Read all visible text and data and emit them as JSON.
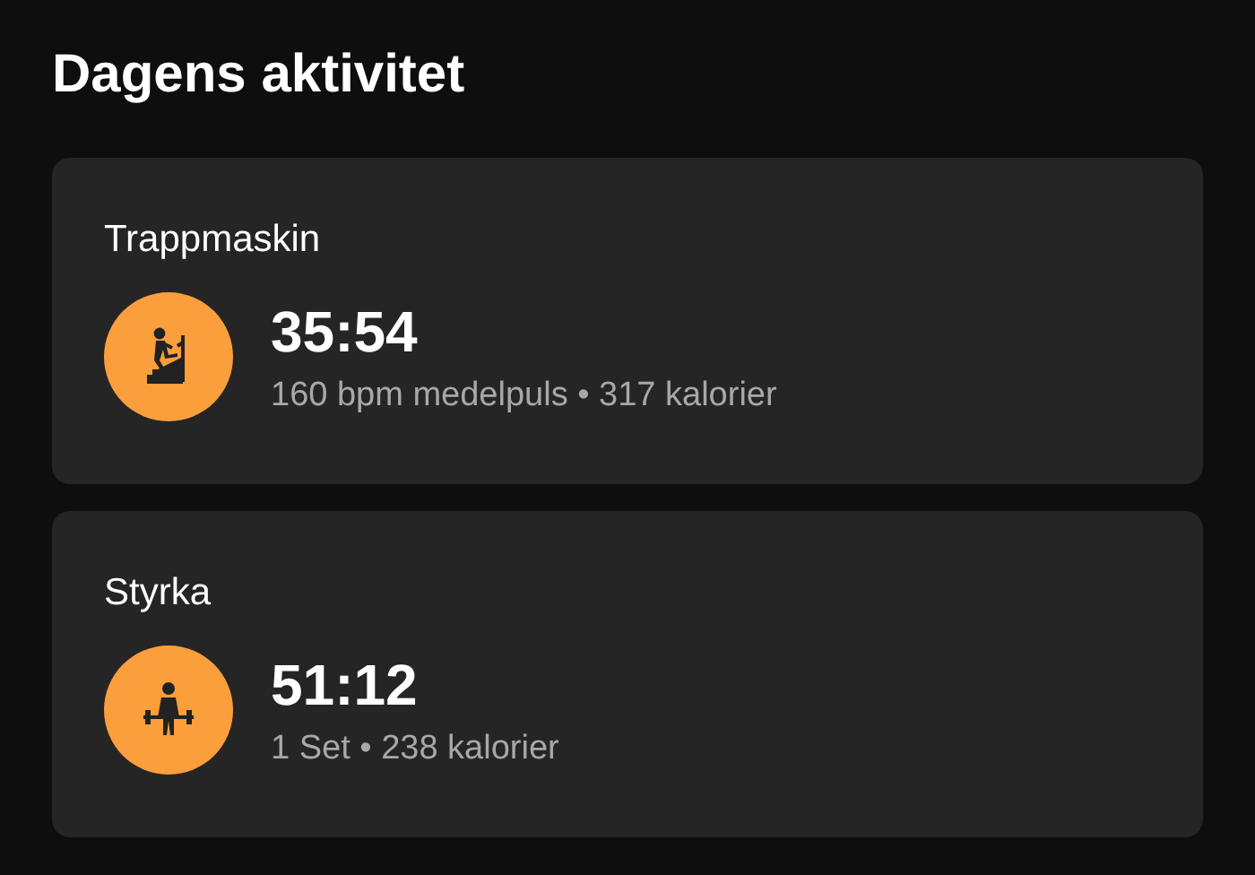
{
  "title": "Dagens aktivitet",
  "activities": [
    {
      "name": "Trappmaskin",
      "kind": "stairs",
      "duration": "35:54",
      "details": "160 bpm medelpuls • 317 kalorier"
    },
    {
      "name": "Styrka",
      "kind": "strength",
      "duration": "51:12",
      "details": "1 Set • 238 kalorier"
    }
  ]
}
